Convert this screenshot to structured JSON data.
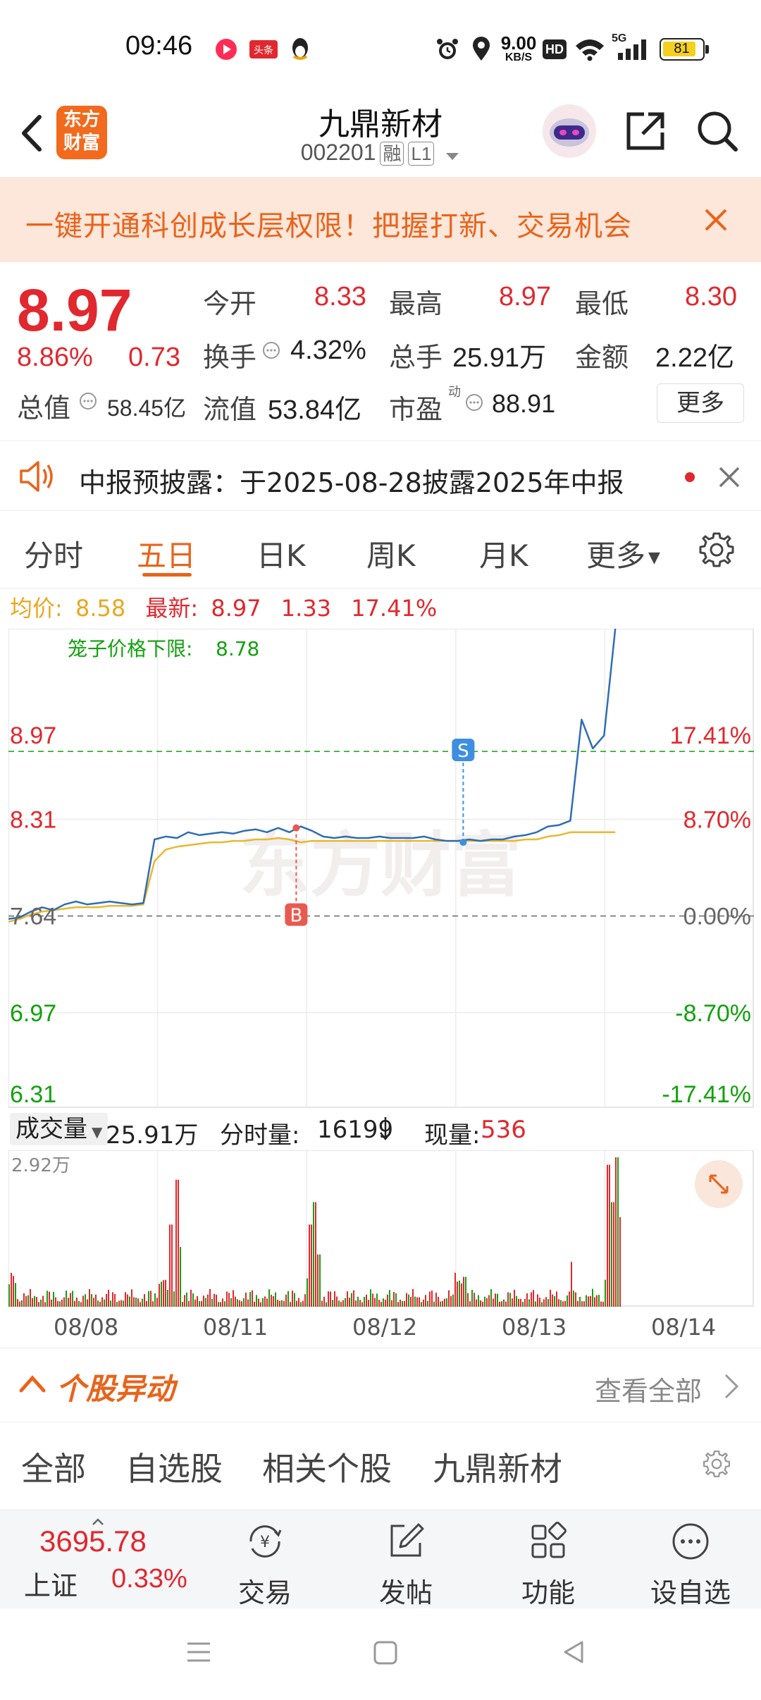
{
  "status_bar": {
    "time": "09:46",
    "net_speed_value": "9.00",
    "net_speed_unit": "KB/S",
    "hd": "HD",
    "signal": "5G",
    "battery": "81"
  },
  "header": {
    "logo_line1": "东方",
    "logo_line2": "财富",
    "stock_name": "九鼎新材",
    "stock_code": "002201",
    "tag_rong": "融",
    "tag_level": "L1"
  },
  "banner": {
    "text": "一键开通科创成长层权限！把握打新、交易机会"
  },
  "quote": {
    "price": "8.97",
    "change_pct": "8.86%",
    "change_amt": "0.73",
    "open_label": "今开",
    "open_value": "8.33",
    "high_label": "最高",
    "high_value": "8.97",
    "low_label": "最低",
    "low_value": "8.30",
    "turnover_label": "换手",
    "turnover_value": "4.32%",
    "volume_label": "总手",
    "volume_value": "25.91万",
    "amount_label": "金额",
    "amount_value": "2.22亿",
    "mktcap_label": "总值",
    "mktcap_value": "58.45亿",
    "float_label": "流值",
    "float_value": "53.84亿",
    "pe_label": "市盈",
    "pe_sup": "动",
    "pe_value": "88.91",
    "more_button": "更多"
  },
  "notice": {
    "text": "中报预披露：于2025-08-28披露2025年中报"
  },
  "tabs": [
    "分时",
    "五日",
    "日K",
    "周K",
    "月K",
    "更多"
  ],
  "legend": {
    "avg_label": "均价:",
    "avg_value": "8.58",
    "latest_label": "最新:",
    "latest_value": "8.97",
    "latest_change": "1.33",
    "latest_pct": "17.41%"
  },
  "chart_labels": {
    "cage_text": "笼子价格下限:",
    "cage_value": "8.78",
    "left_axis": [
      "8.97",
      "8.31",
      "7.64",
      "6.97",
      "6.31"
    ],
    "right_axis": [
      "17.41%",
      "8.70%",
      "0.00%",
      "-8.70%",
      "-17.41%"
    ],
    "marker_b": "B",
    "marker_s": "S",
    "watermark": "东方财富"
  },
  "chart_data": {
    "type": "line",
    "x": [
      "08/08",
      "08/11",
      "08/12",
      "08/13",
      "08/14"
    ],
    "ylim": [
      6.31,
      9.63
    ],
    "reference_close": 7.64,
    "cage_price_floor": 8.78,
    "series": [
      {
        "name": "最新",
        "values": [
          7.62,
          7.63,
          7.67,
          7.7,
          7.68,
          7.72,
          7.74,
          7.72,
          7.73,
          7.74,
          7.73,
          7.72,
          7.73,
          8.17,
          8.19,
          8.18,
          8.22,
          8.2,
          8.21,
          8.22,
          8.21,
          8.23,
          8.24,
          8.22,
          8.25,
          8.22,
          8.26,
          8.23,
          8.19,
          8.18,
          8.19,
          8.18,
          8.18,
          8.19,
          8.18,
          8.18,
          8.18,
          8.19,
          8.17,
          8.16,
          8.16,
          8.17,
          8.16,
          8.17,
          8.17,
          8.19,
          8.2,
          8.22,
          8.26,
          8.27,
          8.3,
          9.0,
          8.8,
          8.89,
          9.63
        ]
      },
      {
        "name": "均价",
        "values": [
          7.6,
          7.62,
          7.65,
          7.67,
          7.68,
          7.69,
          7.7,
          7.7,
          7.7,
          7.71,
          7.71,
          7.71,
          7.72,
          8.02,
          8.1,
          8.12,
          8.13,
          8.14,
          8.15,
          8.15,
          8.16,
          8.16,
          8.17,
          8.17,
          8.18,
          8.17,
          8.15,
          8.16,
          8.16,
          8.16,
          8.16,
          8.16,
          8.16,
          8.16,
          8.16,
          8.16,
          8.16,
          8.16,
          8.16,
          8.16,
          8.16,
          8.16,
          8.16,
          8.16,
          8.16,
          8.16,
          8.17,
          8.17,
          8.19,
          8.2,
          8.22,
          8.22,
          8.22,
          8.22,
          8.22
        ]
      }
    ],
    "trades": [
      {
        "type": "B",
        "date": "08/11",
        "price": 8.25
      },
      {
        "type": "S",
        "date": "08/13",
        "price": 8.15
      }
    ]
  },
  "volume": {
    "selector": "成交量",
    "total": "25.91万",
    "tick_label": "分时量:",
    "tick_value": "16199",
    "now_label": "现量:",
    "now_value": "536",
    "max_label": "2.92万"
  },
  "dates": [
    "08/08",
    "08/11",
    "08/12",
    "08/13",
    "08/14"
  ],
  "abnormal": {
    "title": "个股异动",
    "view_all": "查看全部"
  },
  "filters": [
    "全部",
    "自选股",
    "相关个股",
    "九鼎新材"
  ],
  "bottom_nav": {
    "index_value": "3695.78",
    "index_name": "上证",
    "index_pct": "0.33%",
    "items": [
      "交易",
      "发帖",
      "功能",
      "设自选"
    ]
  },
  "colors": {
    "accent": "#e8641b",
    "up": "#e0282e",
    "down": "#13a10e",
    "price_line": "#2f6db5",
    "avg_line": "#e8b830"
  }
}
